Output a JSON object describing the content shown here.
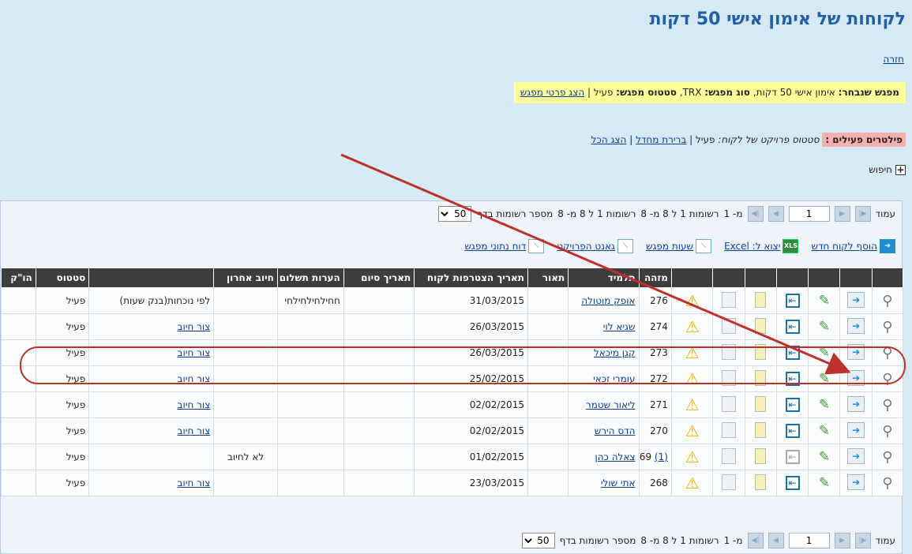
{
  "page": {
    "title": "לקוחות של אימון אישי 50 דקות",
    "back_link": "חזרה"
  },
  "meeting": {
    "label": "מפגש שנבחר:",
    "name": "אימון אישי 50 דקות",
    "type_label": "סוג מפגש:",
    "type_value": "TRX",
    "status_label": "סטטוס מפגש:",
    "status_value": "פעיל",
    "details_link": "הצג פרטי מפגש"
  },
  "filters": {
    "label": "פילטרים פעילים :",
    "text": "סטטוס פרויקט של לקוח:",
    "value": "פעיל",
    "default_link": "ברירת מחדל",
    "show_all_link": "הצג הכל"
  },
  "search": {
    "label": "חיפוש"
  },
  "pager": {
    "page_label": "עמוד",
    "page_value": "1",
    "of_label": "מ- 1",
    "records_text": "רשומות 1 ל 8 מ- 8",
    "per_page_label": "מספר רשומות בדף",
    "per_page_value": "50"
  },
  "toolbar": {
    "add_client": "הוסף לקוח חדש",
    "export": "יצוא ל: Excel",
    "meeting_hours": "שעות מפגש",
    "gantt": "גאנט הפרויקט",
    "report": "דוח נתוני מפגש",
    "xls_icon_text": "XLS"
  },
  "columns": {
    "id": "מזהה",
    "student": "תלמיד",
    "description": "תאור",
    "join_date": "תאריך הצטרפות לקוח",
    "end_date": "תאריך סיום",
    "payment_notes": "הערות תשלום",
    "last_charge": "חיוב אחרון",
    "status": "סטטוס",
    "hk": "הו\"ק"
  },
  "rows": [
    {
      "id": "276",
      "alert": "",
      "student": "אופק מוטולה",
      "join_date": "31/03/2015",
      "payment_notes": "חחילחילחילחי",
      "last_charge": "",
      "charge_cell": "לפי נוכחות(בנק שעות)",
      "charge_is_link": false,
      "status": "פעיל",
      "enter_disabled": false
    },
    {
      "id": "274",
      "alert": "",
      "student": "שגיא לוי",
      "join_date": "26/03/2015",
      "payment_notes": "",
      "last_charge": "",
      "charge_cell": "צור חיוב",
      "charge_is_link": true,
      "status": "פעיל",
      "enter_disabled": false
    },
    {
      "id": "273",
      "alert": "",
      "student": "קגן מיכאל",
      "join_date": "26/03/2015",
      "payment_notes": "",
      "last_charge": "",
      "charge_cell": "צור חיוב",
      "charge_is_link": true,
      "status": "פעיל",
      "enter_disabled": false
    },
    {
      "id": "272",
      "alert": "",
      "student": "עומרי זכאי",
      "join_date": "25/02/2015",
      "payment_notes": "",
      "last_charge": "",
      "charge_cell": "צור חיוב",
      "charge_is_link": true,
      "status": "פעיל",
      "enter_disabled": false
    },
    {
      "id": "271",
      "alert": "",
      "student": "ליאור שטמר",
      "join_date": "02/02/2015",
      "payment_notes": "",
      "last_charge": "",
      "charge_cell": "צור חיוב",
      "charge_is_link": true,
      "status": "פעיל",
      "enter_disabled": false
    },
    {
      "id": "270",
      "alert": "",
      "student": "הדס הירש",
      "join_date": "02/02/2015",
      "payment_notes": "",
      "last_charge": "",
      "charge_cell": "צור חיוב",
      "charge_is_link": true,
      "status": "פעיל",
      "enter_disabled": false
    },
    {
      "id": "269",
      "alert": "(1)",
      "student": "צאלה כהן",
      "join_date": "01/02/2015",
      "payment_notes": "",
      "last_charge": "לא לחיוב",
      "charge_cell": "",
      "charge_is_link": false,
      "status": "פעיל",
      "enter_disabled": true
    },
    {
      "id": "268",
      "alert": "",
      "student": "אתי שולי",
      "join_date": "23/03/2015",
      "payment_notes": "",
      "last_charge": "",
      "charge_cell": "צור חיוב",
      "charge_is_link": true,
      "status": "פעיל",
      "enter_disabled": false
    }
  ],
  "highlighted_row_id": "273",
  "icons": {
    "view": "magnifier-icon",
    "assign": "document-arrow-icon",
    "edit": "pencil-icon",
    "enter": "enter-icon",
    "notes": "notepad-icon",
    "history": "clock-document-icon",
    "alert": "warning-icon"
  },
  "colors": {
    "background": "#d6eaf6",
    "title": "#1f5fa6",
    "header": "#3d3d3d",
    "highlight_box": "#ffff99",
    "filter_label": "#f7b0b0",
    "annotation": "#c0302b"
  }
}
